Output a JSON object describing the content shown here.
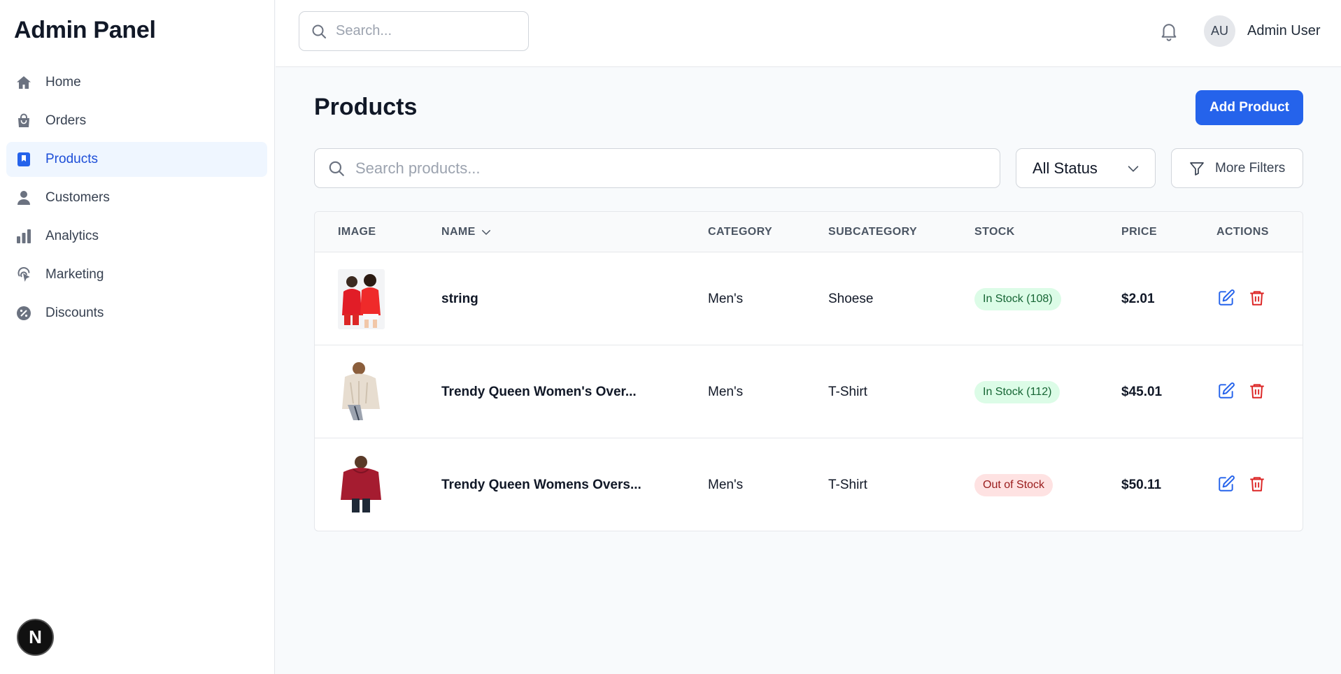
{
  "sidebar": {
    "brand": "Admin Panel",
    "items": [
      {
        "label": "Home",
        "icon": "home-icon",
        "active": false
      },
      {
        "label": "Orders",
        "icon": "shopping-bag-icon",
        "active": false
      },
      {
        "label": "Products",
        "icon": "bookmark-icon",
        "active": true
      },
      {
        "label": "Customers",
        "icon": "user-icon",
        "active": false
      },
      {
        "label": "Analytics",
        "icon": "bar-chart-icon",
        "active": false
      },
      {
        "label": "Marketing",
        "icon": "cursor-click-icon",
        "active": false
      },
      {
        "label": "Discounts",
        "icon": "percent-badge-icon",
        "active": false
      }
    ],
    "footer_badge": "N"
  },
  "topbar": {
    "search_placeholder": "Search...",
    "avatar_initials": "AU",
    "user_name": "Admin User"
  },
  "main": {
    "title": "Products",
    "add_button": "Add Product",
    "search_placeholder": "Search products...",
    "status_filter": "All Status",
    "more_filters": "More Filters"
  },
  "table": {
    "columns": {
      "image": "IMAGE",
      "name": "NAME",
      "category": "CATEGORY",
      "subcategory": "SUBCATEGORY",
      "stock": "STOCK",
      "price": "PRICE",
      "actions": "ACTIONS"
    },
    "rows": [
      {
        "name": "string",
        "category": "Men's",
        "subcategory": "Shoese",
        "stock": "In Stock (108)",
        "stock_status": "in",
        "price": "$2.01"
      },
      {
        "name": "Trendy Queen Women's Over...",
        "category": "Men's",
        "subcategory": "T-Shirt",
        "stock": "In Stock (112)",
        "stock_status": "in",
        "price": "$45.01"
      },
      {
        "name": "Trendy Queen Womens Overs...",
        "category": "Men's",
        "subcategory": "T-Shirt",
        "stock": "Out of Stock",
        "stock_status": "out",
        "price": "$50.11"
      }
    ]
  },
  "colors": {
    "accent": "#2563eb",
    "active_nav_bg": "#eff6ff",
    "in_stock_bg": "#dcfce7",
    "out_stock_bg": "#fee2e2",
    "delete": "#dc2626"
  }
}
